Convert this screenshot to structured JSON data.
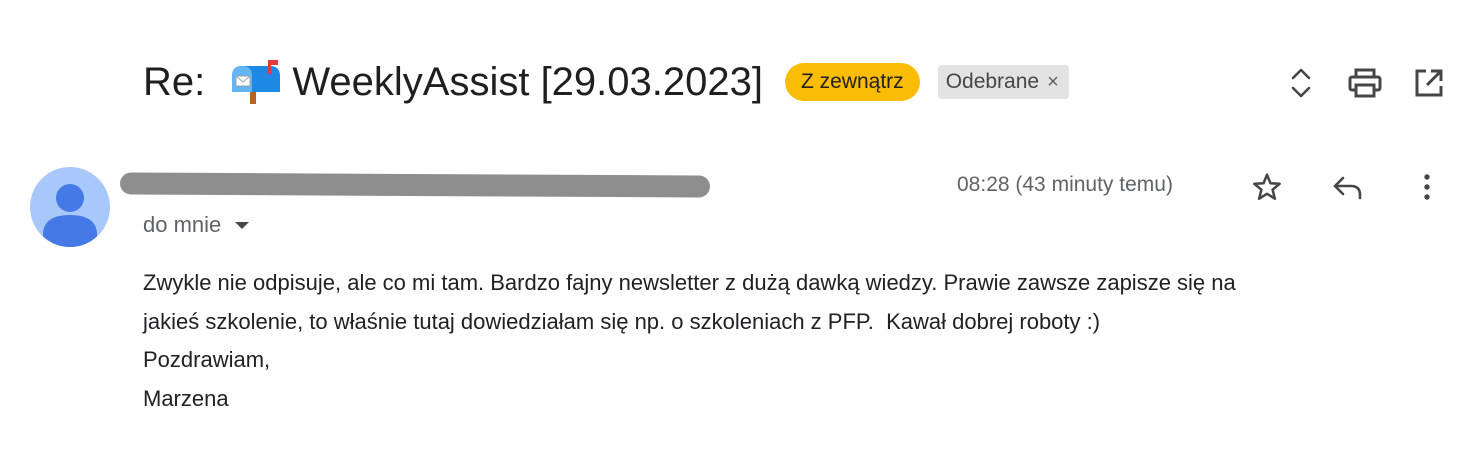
{
  "subject": {
    "prefix": "Re: ",
    "title": "WeeklyAssist [29.03.2023]",
    "icon": "mailbox-with-mail-icon"
  },
  "labels": {
    "external": "Z zewnątrz",
    "inbox": "Odebrane",
    "inbox_remove": "×"
  },
  "colors": {
    "external_label_bg": "#fbbc04",
    "inbox_label_bg": "#e3e3e3",
    "avatar_bg": "#a8c7fa",
    "avatar_fg": "#4285f4"
  },
  "sender": {
    "to_line": "do mnie"
  },
  "timestamp": "08:28 (43 minuty temu)",
  "top_actions": [
    "expand-collapse-icon",
    "print-icon",
    "open-in-new-window-icon"
  ],
  "row_actions": [
    "star-icon",
    "reply-icon",
    "more-vert-icon"
  ],
  "body": {
    "lines": [
      "Zwykle nie odpisuje, ale co mi tam. Bardzo fajny newsletter z dużą dawką wiedzy. Prawie zawsze zapisze się na",
      "jakieś szkolenie, to właśnie tutaj dowiedziałam się np. o szkoleniach z PFP.  Kawał dobrej roboty :)",
      "Pozdrawiam,",
      "Marzena"
    ]
  }
}
